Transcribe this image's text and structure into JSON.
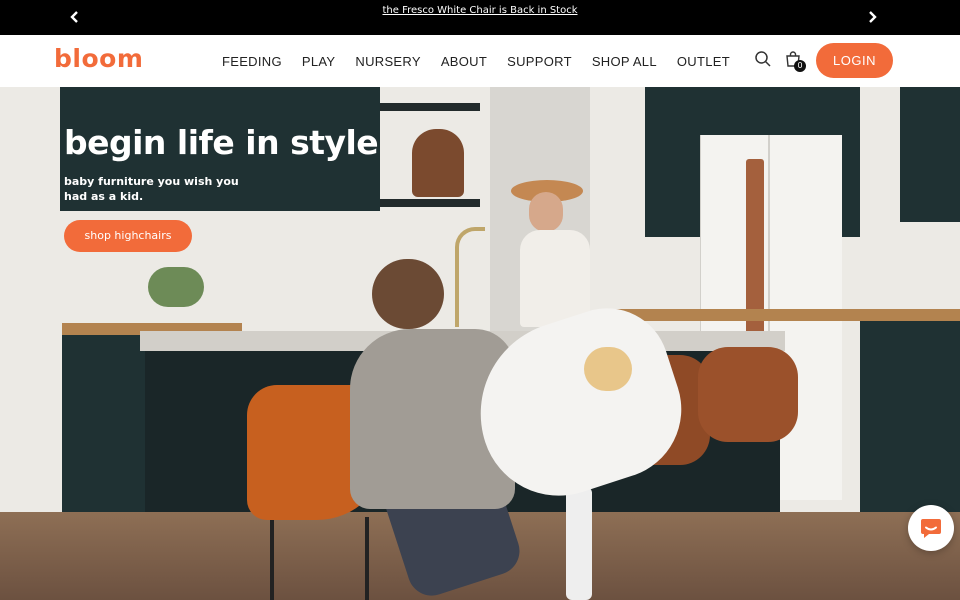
{
  "announcement": {
    "message": "the Fresco White Chair is Back in Stock",
    "prev_icon": "chevron-left-icon",
    "next_icon": "chevron-right-icon"
  },
  "header": {
    "logo": "bloom",
    "nav": [
      "FEEDING",
      "PLAY",
      "NURSERY",
      "ABOUT",
      "SUPPORT",
      "SHOP ALL",
      "OUTLET"
    ],
    "search_icon": "search-icon",
    "cart_icon": "shopping-bag-icon",
    "cart_count": "0",
    "login_label": "LOGIN"
  },
  "hero": {
    "title": "begin life in style",
    "subtitle": "baby furniture you wish you had as a kid.",
    "cta_label": "shop highchairs"
  },
  "chat": {
    "icon": "chat-bubble-icon"
  },
  "colors": {
    "brand": "#f26b3a",
    "announcement_bg": "#000000",
    "text_dark": "#222222"
  }
}
